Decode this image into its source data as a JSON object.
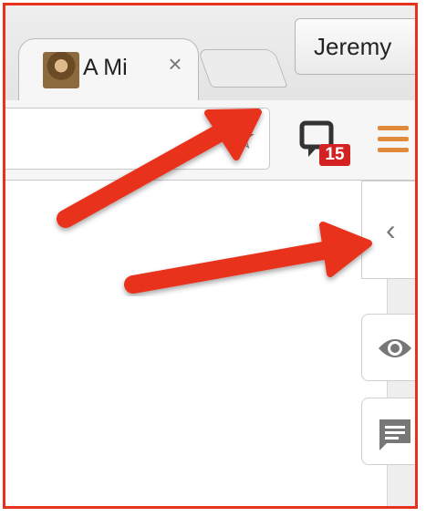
{
  "browser": {
    "tab": {
      "title": "A Mi",
      "close_icon": "close-icon",
      "favicon": "portrait-favicon"
    },
    "profile_name": "Jeremy"
  },
  "toolbar": {
    "bookmark_icon": "star-icon",
    "extension": {
      "icon": "chat-icon",
      "badge": "15",
      "badge_color": "#d42121"
    },
    "menu_icon": "hamburger-icon",
    "menu_color": "#e08a3a"
  },
  "sidebar": {
    "collapse_icon": "chevron-left-icon",
    "buttons": [
      {
        "icon": "eye-icon"
      },
      {
        "icon": "comment-icon"
      }
    ]
  },
  "annotation": {
    "arrow_color": "#e8321e",
    "frame_color": "#e8321e"
  }
}
